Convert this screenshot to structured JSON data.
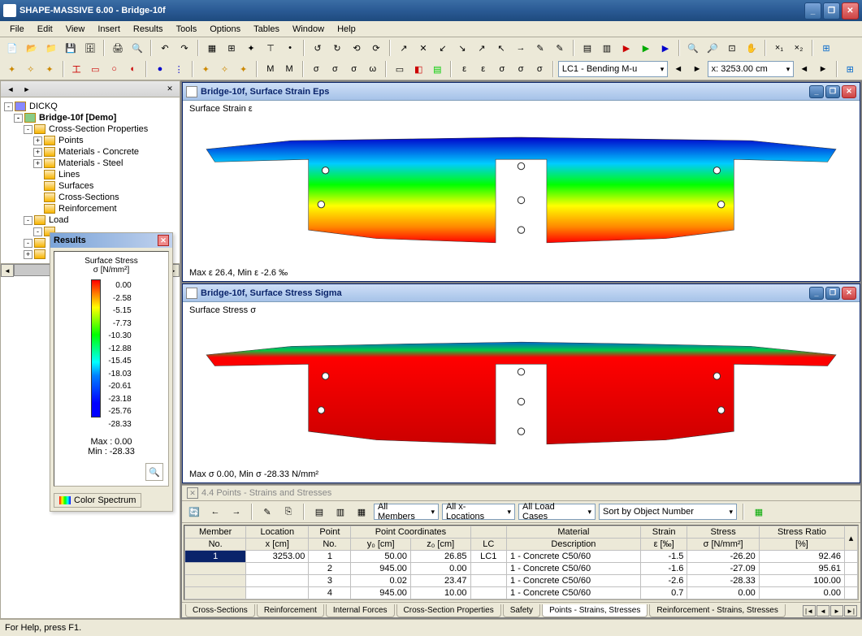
{
  "app": {
    "title": "SHAPE-MASSIVE 6.00 - Bridge-10f"
  },
  "menu": [
    "File",
    "Edit",
    "View",
    "Insert",
    "Results",
    "Tools",
    "Options",
    "Tables",
    "Window",
    "Help"
  ],
  "toolbar2": {
    "combo1": "LC1 - Bending M-u",
    "combo2_label": "x:",
    "combo2_value": "3253.00 cm"
  },
  "sidebar": {
    "root": "DICKQ",
    "project": "Bridge-10f [Demo]",
    "nodes": {
      "csp": "Cross-Section Properties",
      "points": "Points",
      "matc": "Materials - Concrete",
      "mats": "Materials - Steel",
      "lines": "Lines",
      "surfaces": "Surfaces",
      "cs": "Cross-Sections",
      "reinf": "Reinforcement",
      "load": "Load"
    }
  },
  "results_panel": {
    "title": "Results",
    "heading_l1": "Surface Stress",
    "heading_l2": "σ      [N/mm²]",
    "legend": [
      "0.00",
      "-2.58",
      "-5.15",
      "-7.73",
      "-10.30",
      "-12.88",
      "-15.45",
      "-18.03",
      "-20.61",
      "-23.18",
      "-25.76",
      "-28.33"
    ],
    "max_label": "Max :",
    "max_value": "0.00",
    "min_label": "Min :",
    "min_value": "-28.33",
    "spectrum_btn": "Color Spectrum"
  },
  "sub1": {
    "title": "Bridge-10f, Surface Strain Eps",
    "caption": "Surface Strain ε",
    "bottom": "Max ε 26.4, Min ε -2.6 ‰"
  },
  "sub2": {
    "title": "Bridge-10f, Surface Stress Sigma",
    "caption": "Surface Stress σ",
    "bottom": "Max σ 0.00, Min σ -28.33 N/mm²"
  },
  "table_panel": {
    "title": "4.4 Points - Strains and Stresses",
    "filters": [
      "All Members",
      "All x-Locations",
      "All Load Cases",
      "Sort by Object Number"
    ],
    "headers_row1": [
      "Member",
      "Location",
      "Point",
      "Point Coordinates",
      "",
      "Material",
      "Strain",
      "Stress",
      "Stress Ratio"
    ],
    "headers_row2": [
      "No.",
      "x [cm]",
      "No.",
      "y₀ [cm]",
      "z₀ [cm]",
      "LC",
      "Description",
      "ε [‰]",
      "σ [N/mm²]",
      "[%]"
    ],
    "rows": [
      {
        "no": "1",
        "x": "3253.00",
        "pt": "1",
        "y0": "50.00",
        "z0": "26.85",
        "lc": "LC1",
        "mat": "1 - Concrete C50/60",
        "strain": "-1.5",
        "stress": "-26.20",
        "ratio": "92.46"
      },
      {
        "no": "",
        "x": "",
        "pt": "2",
        "y0": "945.00",
        "z0": "0.00",
        "lc": "",
        "mat": "1 - Concrete C50/60",
        "strain": "-1.6",
        "stress": "-27.09",
        "ratio": "95.61"
      },
      {
        "no": "",
        "x": "",
        "pt": "3",
        "y0": "0.02",
        "z0": "23.47",
        "lc": "",
        "mat": "1 - Concrete C50/60",
        "strain": "-2.6",
        "stress": "-28.33",
        "ratio": "100.00"
      },
      {
        "no": "",
        "x": "",
        "pt": "4",
        "y0": "945.00",
        "z0": "10.00",
        "lc": "",
        "mat": "1 - Concrete C50/60",
        "strain": "0.7",
        "stress": "0.00",
        "ratio": "0.00"
      }
    ],
    "tabs": [
      "Cross-Sections",
      "Reinforcement",
      "Internal Forces",
      "Cross-Section Properties",
      "Safety",
      "Points - Strains, Stresses",
      "Reinforcement - Strains, Stresses"
    ]
  },
  "status": "For Help, press F1."
}
